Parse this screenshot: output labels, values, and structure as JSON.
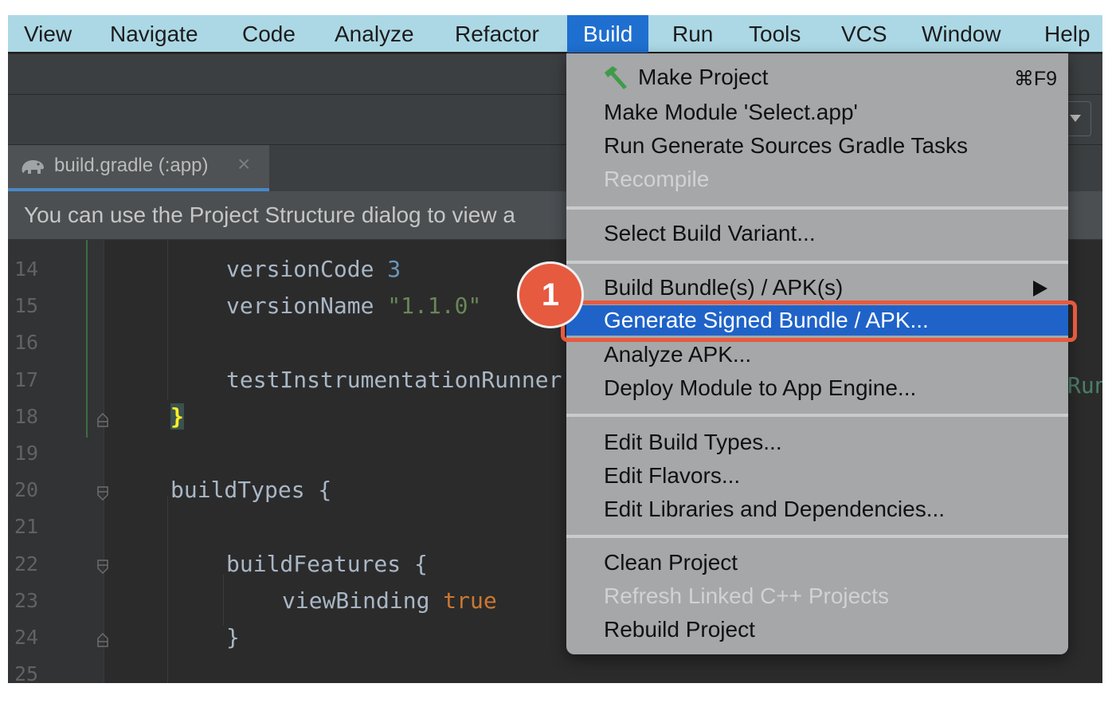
{
  "menubar": {
    "items": [
      "View",
      "Navigate",
      "Code",
      "Analyze",
      "Refactor",
      "Build",
      "Run",
      "Tools",
      "VCS",
      "Window",
      "Help"
    ],
    "active": "Build"
  },
  "editor_tab": {
    "icon": "gradle-elephant-icon",
    "label": "build.gradle (:app)",
    "close": "×"
  },
  "banner": {
    "text": "You can use the Project Structure dialog to view a"
  },
  "code": {
    "line_numbers": [
      "14",
      "15",
      "16",
      "17",
      "18",
      "19",
      "20",
      "21",
      "22",
      "23",
      "24",
      "25"
    ],
    "lines": [
      {
        "tokens": [
          {
            "t": "versionCode ",
            "c": ""
          },
          {
            "t": "3",
            "c": "num"
          }
        ]
      },
      {
        "tokens": [
          {
            "t": "versionName ",
            "c": ""
          },
          {
            "t": "\"1.1.0\"",
            "c": "str"
          }
        ]
      },
      {
        "tokens": []
      },
      {
        "tokens": [
          {
            "t": "testInstrumentationRunner",
            "c": ""
          }
        ]
      },
      {
        "tokens": [
          {
            "t": "}",
            "c": "brace"
          }
        ]
      },
      {
        "tokens": []
      },
      {
        "tokens": [
          {
            "t": "buildTypes {",
            "c": ""
          }
        ]
      },
      {
        "tokens": []
      },
      {
        "tokens": [
          {
            "t": "buildFeatures {",
            "c": ""
          }
        ]
      },
      {
        "tokens": [
          {
            "t": "viewBinding ",
            "c": ""
          },
          {
            "t": "true",
            "c": "kw"
          }
        ]
      },
      {
        "tokens": [
          {
            "t": "}",
            "c": ""
          }
        ]
      },
      {
        "tokens": []
      }
    ],
    "overflow_text": "Run"
  },
  "build_menu": {
    "make_project": {
      "label": "Make Project",
      "shortcut": "⌘F9",
      "icon": "hammer-icon"
    },
    "make_module": "Make Module 'Select.app'",
    "run_generate_sources": "Run Generate Sources Gradle Tasks",
    "recompile": "Recompile",
    "select_build_variant": "Select Build Variant...",
    "build_bundles": "Build Bundle(s) / APK(s)",
    "generate_signed": "Generate Signed Bundle / APK...",
    "analyze_apk": "Analyze APK...",
    "deploy_module": "Deploy Module to App Engine...",
    "edit_build_types": "Edit Build Types...",
    "edit_flavors": "Edit Flavors...",
    "edit_libraries": "Edit Libraries and Dependencies...",
    "clean_project": "Clean Project",
    "refresh_cpp": "Refresh Linked C++ Projects",
    "rebuild_project": "Rebuild Project"
  },
  "callout": {
    "number": "1"
  },
  "colors": {
    "menubar_bg": "#acd8e5",
    "menu_active": "#1f6fd0",
    "menu_bg": "#a5a7a9",
    "highlight": "#1f63c9",
    "callout": "#e65a3f",
    "editor_bg": "#2b2b2b"
  }
}
